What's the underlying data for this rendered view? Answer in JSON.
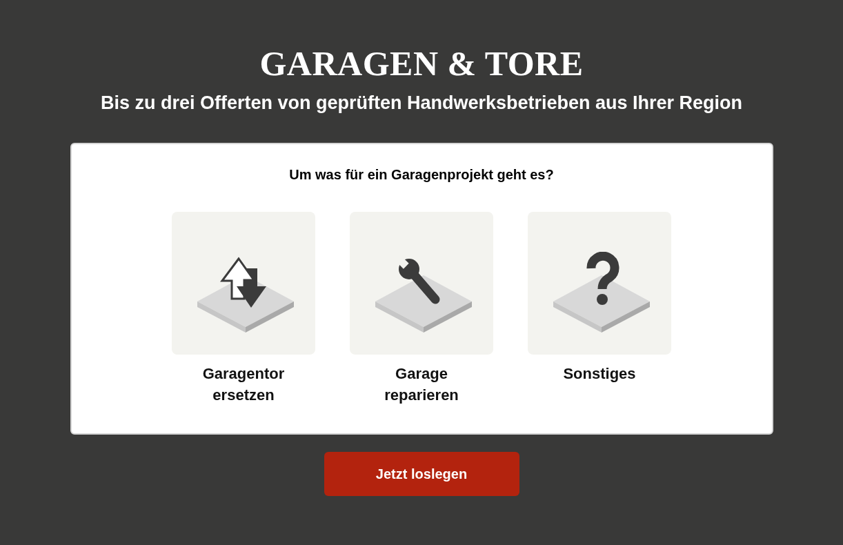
{
  "header": {
    "title": "GARAGEN & TORE",
    "subtitle": "Bis zu drei Offerten von geprüften Handwerksbetrieben aus Ihrer Region"
  },
  "card": {
    "question": "Um was für ein Garagenprojekt geht es?",
    "options": [
      {
        "kind": "swap",
        "label": "Garagentor ersetzen"
      },
      {
        "kind": "repair",
        "label": "Garage reparieren"
      },
      {
        "kind": "other",
        "label": "Sonstiges"
      }
    ]
  },
  "cta_button": {
    "label": "Jetzt loslegen"
  }
}
